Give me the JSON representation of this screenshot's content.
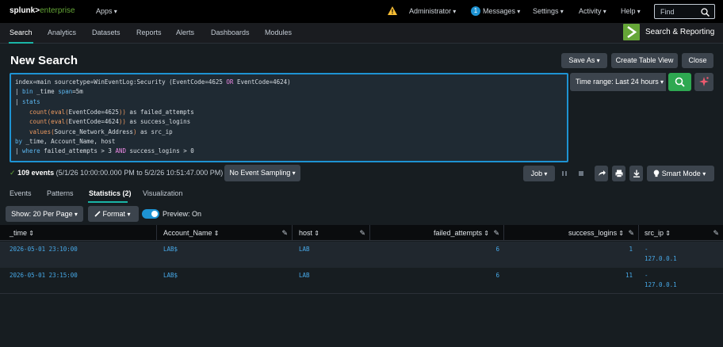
{
  "topbar": {
    "logo_left": "splunk>",
    "logo_right": "enterprise",
    "apps_menu": "Apps",
    "warning_icon": "warning-icon",
    "user_menu": "Administrator",
    "messages_count": "1",
    "messages_menu": "Messages",
    "settings_menu": "Settings",
    "activity_menu": "Activity",
    "help_menu": "Help",
    "find_placeholder": "Find"
  },
  "nav": {
    "tabs": [
      "Search",
      "Analytics",
      "Datasets",
      "Reports",
      "Alerts",
      "Dashboards",
      "Modules"
    ],
    "active_tab": "Search",
    "app_name": "Search & Reporting"
  },
  "page": {
    "title": "New Search",
    "save_as": "Save As",
    "create_table_view": "Create Table View",
    "close": "Close"
  },
  "query": {
    "line1_a": "index=main sourcetype=WinEventLog:Security (EventCode=4625 ",
    "line1_or": "OR",
    "line1_b": " EventCode=4624)",
    "line2_pipe": "| ",
    "line2_cmd": "bin",
    "line2_rest": " _time ",
    "line2_arg": "span",
    "line2_val": "=5m",
    "line3_pipe": "| ",
    "line3_cmd": "stats",
    "line4_fn": "count(eval(",
    "line4_mid": "EventCode=4625",
    "line4_close": "))",
    "line4_as": " as ",
    "line4_alias": "failed_attempts",
    "line5_fn": "count(eval(",
    "line5_mid": "EventCode=4624",
    "line5_close": "))",
    "line5_as": " as ",
    "line5_alias": "success_logins",
    "line6_fn": "values(",
    "line6_mid": "Source_Network_Address",
    "line6_close": ")",
    "line6_as": " as ",
    "line6_alias": "src_ip",
    "line7_by": "by",
    "line7_rest": " _time, Account_Name, host",
    "line8_pipe": "| ",
    "line8_cmd": "where",
    "line8_a": " failed_attempts > 3 ",
    "line8_and": "AND",
    "line8_b": " success_logins > 0"
  },
  "time_range": {
    "label": "Time range: Last 24 hours"
  },
  "status": {
    "check": "✓",
    "events": "109 events",
    "range": "(5/1/26 10:00:00.000 PM to 5/2/26 10:51:47.000 PM)",
    "sampling": "No Event Sampling",
    "job": "Job",
    "smart_mode": "Smart Mode"
  },
  "result_tabs": [
    "Events",
    "Patterns",
    "Statistics (2)",
    "Visualization"
  ],
  "result_active": "Statistics (2)",
  "toolbar": {
    "show": "Show: 20 Per Page",
    "format": "Format",
    "preview": "Preview: On"
  },
  "table": {
    "columns": [
      "_time",
      "Account_Name",
      "host",
      "failed_attempts",
      "success_logins",
      "src_ip"
    ],
    "rows": [
      {
        "time": "2026-05-01 23:10:00",
        "account": "LAB$",
        "host": "LAB",
        "failed": "6",
        "success": "1",
        "src_dash": "-",
        "src_ip": "127.0.0.1"
      },
      {
        "time": "2026-05-01 23:15:00",
        "account": "LAB$",
        "host": "LAB",
        "failed": "6",
        "success": "11",
        "src_dash": "-",
        "src_ip": "127.0.0.1"
      }
    ]
  },
  "colors": {
    "accent": "#1e93d3",
    "teal": "#1ab5a6",
    "search_green": "#2ea851",
    "app_green": "#65a637",
    "warning": "#f8be34"
  }
}
